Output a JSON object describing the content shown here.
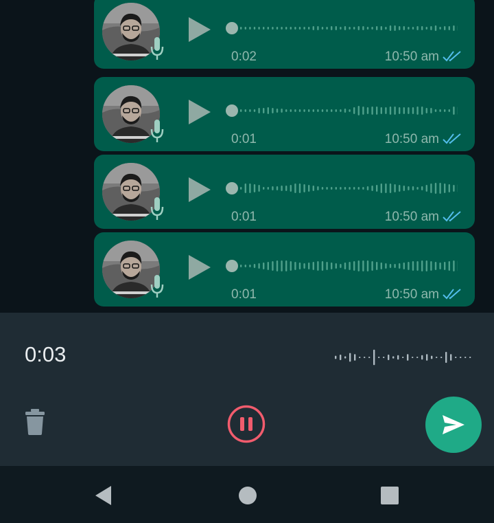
{
  "messages": [
    {
      "duration": "0:02",
      "time": "10:50 am",
      "status": "read"
    },
    {
      "duration": "0:01",
      "time": "10:50 am",
      "status": "read"
    },
    {
      "duration": "0:01",
      "time": "10:50 am",
      "status": "read"
    },
    {
      "duration": "0:01",
      "time": "10:50 am",
      "status": "read"
    }
  ],
  "recorder": {
    "elapsed": "0:03",
    "icons": {
      "delete": "trash-icon",
      "pause": "pause-icon",
      "send": "send-icon"
    }
  },
  "navigation": {
    "icons": [
      "back-triangle-icon",
      "home-circle-icon",
      "recents-square-icon"
    ]
  },
  "colors": {
    "background": "#0b141a",
    "bubble": "#005c4b",
    "recorder_bar": "#1f2c34",
    "send_button": "#1faa87",
    "pause_ring": "#f15c6d",
    "read_ticks": "#53bdeb"
  }
}
